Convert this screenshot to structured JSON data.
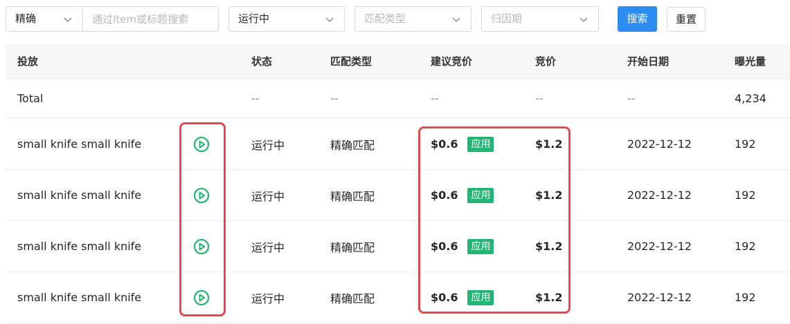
{
  "filters": {
    "match_mode": "精确",
    "search_placeholder": "通过Item或标题搜索",
    "status": "运行中",
    "match_type_placeholder": "匹配类型",
    "attribution_placeholder": "归因期",
    "search_button": "搜索",
    "reset_button": "重置"
  },
  "table": {
    "columns": [
      "投放",
      "状态",
      "匹配类型",
      "建议竞价",
      "竞价",
      "开始日期",
      "曝光量"
    ],
    "total": {
      "label": "Total",
      "status": "--",
      "match_type": "--",
      "suggested_bid": "--",
      "bid": "--",
      "start_date": "--",
      "impressions": "4,234"
    },
    "rows": [
      {
        "name": "small knife small knife",
        "status": "运行中",
        "match_type": "精确匹配",
        "suggested_bid": "$0.6",
        "apply_label": "应用",
        "bid": "$1.2",
        "start_date": "2022-12-12",
        "impressions": "192"
      },
      {
        "name": "small knife small knife",
        "status": "运行中",
        "match_type": "精确匹配",
        "suggested_bid": "$0.6",
        "apply_label": "应用",
        "bid": "$1.2",
        "start_date": "2022-12-12",
        "impressions": "192"
      },
      {
        "name": "small knife small knife",
        "status": "运行中",
        "match_type": "精确匹配",
        "suggested_bid": "$0.6",
        "apply_label": "应用",
        "bid": "$1.2",
        "start_date": "2022-12-12",
        "impressions": "192"
      },
      {
        "name": "small knife small knife",
        "status": "运行中",
        "match_type": "精确匹配",
        "suggested_bid": "$0.6",
        "apply_label": "应用",
        "bid": "$1.2",
        "start_date": "2022-12-12",
        "impressions": "192"
      }
    ]
  },
  "icons": {
    "row_action": "play-circle-icon",
    "dropdown": "chevron-down-icon"
  },
  "colors": {
    "primary": "#2d8cf0",
    "play_icon": "#22b573",
    "apply_badge": "#22b573",
    "highlight": "#e5484d",
    "header_bg": "#f6f7f9"
  }
}
